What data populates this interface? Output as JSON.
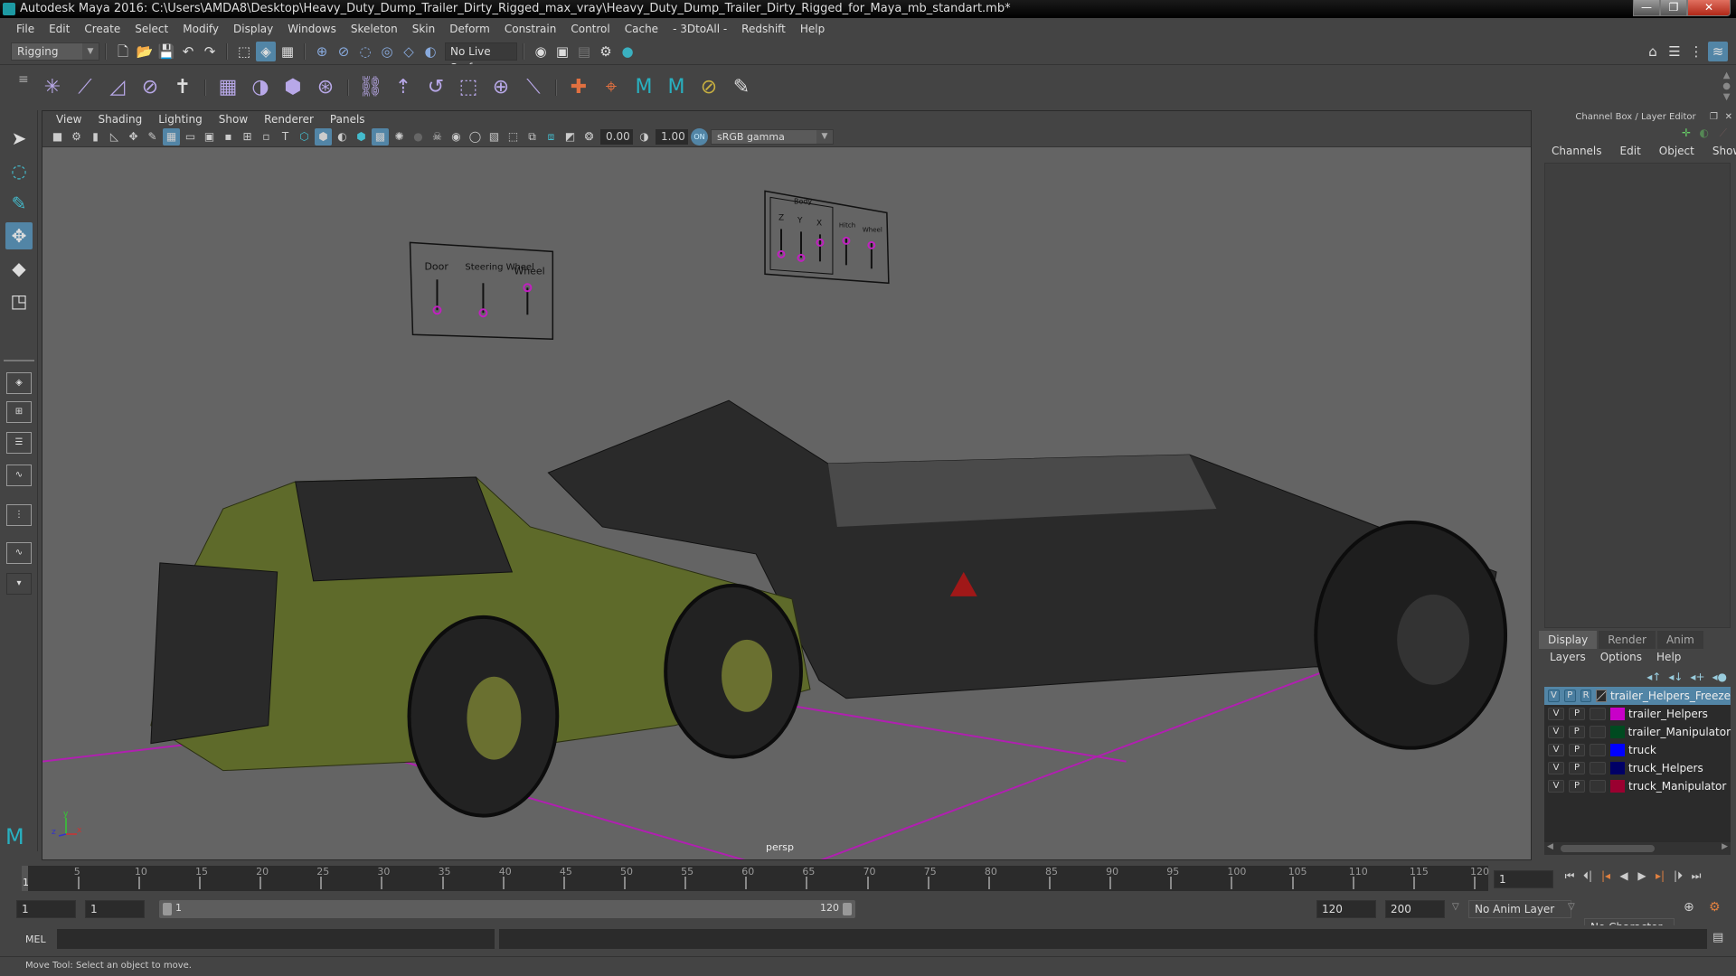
{
  "window": {
    "title": "Autodesk Maya 2016: C:\\Users\\AMDA8\\Desktop\\Heavy_Duty_Dump_Trailer_Dirty_Rigged_max_vray\\Heavy_Duty_Dump_Trailer_Dirty_Rigged_for_Maya_mb_standart.mb*",
    "minimize": "—",
    "restore": "❐",
    "close": "✕"
  },
  "menubar": [
    "File",
    "Edit",
    "Create",
    "Select",
    "Modify",
    "Display",
    "Windows",
    "Skeleton",
    "Skin",
    "Deform",
    "Constrain",
    "Control",
    "Cache",
    "- 3DtoAll -",
    "Redshift",
    "Help"
  ],
  "status_line": {
    "menu_set": "Rigging",
    "live_surface": "No Live Surface"
  },
  "viewport": {
    "menus": [
      "View",
      "Shading",
      "Lighting",
      "Show",
      "Renderer",
      "Panels"
    ],
    "exposure": "0.00",
    "gamma": "1.00",
    "color_mgmt": "ON",
    "color_space": "sRGB gamma",
    "camera": "persp",
    "axis": {
      "x": "x",
      "y": "y",
      "z": "z"
    },
    "control_panel_left": {
      "labels": [
        "Door",
        "Steering Wheel",
        "Wheel"
      ]
    },
    "control_panel_right": {
      "group": "Body",
      "labels": [
        "Z",
        "Y",
        "X",
        "Hitch",
        "Wheel"
      ]
    }
  },
  "channel_box": {
    "header": "Channel Box / Layer Editor",
    "menus": [
      "Channels",
      "Edit",
      "Object",
      "Show"
    ]
  },
  "layer_editor": {
    "tabs": [
      "Display",
      "Render",
      "Anim"
    ],
    "active_tab": "Display",
    "menus": [
      "Layers",
      "Options",
      "Help"
    ],
    "layers": [
      {
        "v": "V",
        "p": "P",
        "r": "R",
        "name": "trailer_Helpers_Freeze",
        "color": "#2b2b2b",
        "selected": true
      },
      {
        "v": "V",
        "p": "P",
        "r": "",
        "name": "trailer_Helpers",
        "color": "#c800c8",
        "selected": false
      },
      {
        "v": "V",
        "p": "P",
        "r": "",
        "name": "trailer_Manipulator",
        "color": "#004a20",
        "selected": false
      },
      {
        "v": "V",
        "p": "P",
        "r": "",
        "name": "truck",
        "color": "#0000ff",
        "selected": false
      },
      {
        "v": "V",
        "p": "P",
        "r": "",
        "name": "truck_Helpers",
        "color": "#000066",
        "selected": false
      },
      {
        "v": "V",
        "p": "P",
        "r": "",
        "name": "truck_Manipulator",
        "color": "#9a0030",
        "selected": false
      }
    ]
  },
  "timeline": {
    "ticks": [
      "5",
      "10",
      "15",
      "20",
      "25",
      "30",
      "35",
      "40",
      "45",
      "50",
      "55",
      "60",
      "65",
      "70",
      "75",
      "80",
      "85",
      "90",
      "95",
      "100",
      "105",
      "110",
      "115",
      "120"
    ],
    "current_frame": "1",
    "current_frame_field": "1"
  },
  "range": {
    "start": "1",
    "anim_start": "1",
    "slider_start": "1",
    "slider_end": "120",
    "end": "120",
    "anim_end": "200",
    "anim_layer": "No Anim Layer",
    "character_set": "No Character Set"
  },
  "command_line": {
    "language": "MEL",
    "value": "",
    "result": ""
  },
  "help_line": "Move Tool: Select an object to move."
}
